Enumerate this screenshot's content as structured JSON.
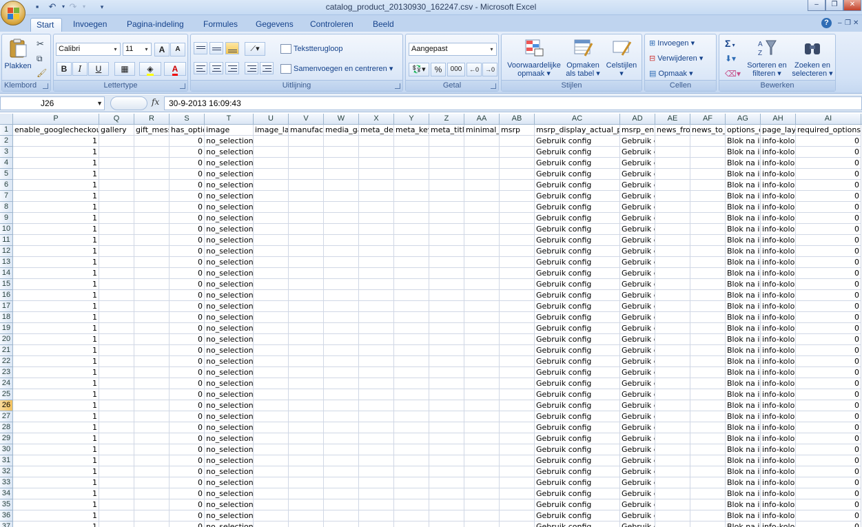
{
  "window": {
    "title": "catalog_product_20130930_162247.csv - Microsoft Excel",
    "minimize": "–",
    "restore": "❐",
    "close": "✕"
  },
  "quick_access": {
    "save_icon": "save-icon",
    "undo_icon": "undo-icon",
    "redo_icon": "redo-icon"
  },
  "tabs": [
    "Start",
    "Invoegen",
    "Pagina-indeling",
    "Formules",
    "Gegevens",
    "Controleren",
    "Beeld"
  ],
  "active_tab": "Start",
  "ribbon": {
    "clipboard": {
      "paste": "Plakken",
      "label": "Klembord"
    },
    "font": {
      "name": "Calibri",
      "size": "11",
      "bold": "B",
      "italic": "I",
      "underline": "U",
      "grow": "A",
      "shrink": "A",
      "color": "A",
      "label": "Lettertype"
    },
    "alignment": {
      "wrap": "Tekstterugloop",
      "merge": "Samenvoegen en centreren",
      "label": "Uitlijning"
    },
    "number": {
      "format": "Aangepast",
      "percent": "%",
      "thousands": "000",
      "label": "Getal"
    },
    "styles": {
      "conditional_1": "Voorwaardelijke",
      "conditional_2": "opmaak",
      "table_1": "Opmaken",
      "table_2": "als tabel",
      "cell_styles": "Celstijlen",
      "label": "Stijlen"
    },
    "cells": {
      "insert": "Invoegen",
      "delete": "Verwijderen",
      "format": "Opmaak",
      "label": "Cellen"
    },
    "editing": {
      "sort_1": "Sorteren en",
      "sort_2": "filteren",
      "find_1": "Zoeken en",
      "find_2": "selecteren",
      "sum": "Σ",
      "label": "Bewerken"
    }
  },
  "formula_bar": {
    "name_box": "J26",
    "fx": "fx",
    "value": "30-9-2013  16:09:43"
  },
  "columns": [
    {
      "letter": "P",
      "header": "enable_googlecheckout"
    },
    {
      "letter": "Q",
      "header": "gallery"
    },
    {
      "letter": "R",
      "header": "gift_message_available"
    },
    {
      "letter": "S",
      "header": "has_options"
    },
    {
      "letter": "T",
      "header": "image"
    },
    {
      "letter": "U",
      "header": "image_label"
    },
    {
      "letter": "V",
      "header": "manufacturer"
    },
    {
      "letter": "W",
      "header": "media_gallery"
    },
    {
      "letter": "X",
      "header": "meta_description"
    },
    {
      "letter": "Y",
      "header": "meta_keyword"
    },
    {
      "letter": "Z",
      "header": "meta_title"
    },
    {
      "letter": "AA",
      "header": "minimal_price"
    },
    {
      "letter": "AB",
      "header": "msrp"
    },
    {
      "letter": "AC",
      "header": "msrp_display_actual_price_type"
    },
    {
      "letter": "AD",
      "header": "msrp_enabled"
    },
    {
      "letter": "AE",
      "header": "news_from_date"
    },
    {
      "letter": "AF",
      "header": "news_to_date"
    },
    {
      "letter": "AG",
      "header": "options_container"
    },
    {
      "letter": "AH",
      "header": "page_layout"
    },
    {
      "letter": "AI",
      "header": "required_options"
    }
  ],
  "row_values": {
    "P": "1",
    "S": "0",
    "T": "no_selection",
    "AC": "Gebruik config",
    "AD": "Gebruik config",
    "AG": "Blok na info-kolom",
    "AH": "info-kolom",
    "AI": "0"
  },
  "rows": [
    "1",
    "2",
    "3",
    "4",
    "5",
    "6",
    "7",
    "8",
    "9",
    "10",
    "11",
    "12",
    "13",
    "14",
    "15",
    "16",
    "17",
    "18",
    "19",
    "20",
    "21",
    "22",
    "23",
    "24",
    "25",
    "26",
    "27",
    "28",
    "29",
    "30",
    "31",
    "32",
    "33",
    "34",
    "35",
    "36",
    "37"
  ],
  "selected_row": "26"
}
